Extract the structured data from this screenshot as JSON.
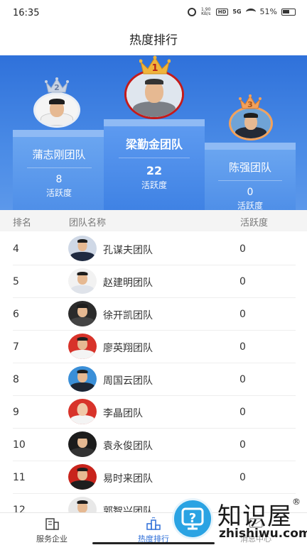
{
  "status_bar": {
    "time": "16:35",
    "net_speed": "1.90 KB/s",
    "hd": "HD",
    "network": "5G",
    "battery": "51%"
  },
  "page": {
    "title": "热度排行"
  },
  "podium": [
    {
      "rank": "2",
      "name": "蒲志刚团队",
      "score": "8",
      "label": "活跃度"
    },
    {
      "rank": "1",
      "name": "梁勤金团队",
      "score": "22",
      "label": "活跃度"
    },
    {
      "rank": "3",
      "name": "陈强团队",
      "score": "0",
      "label": "活跃度"
    }
  ],
  "table": {
    "headers": {
      "rank": "排名",
      "team": "团队名称",
      "activity": "活跃度"
    },
    "rows": [
      {
        "rank": "4",
        "name": "孔谋夫团队",
        "activity": "0"
      },
      {
        "rank": "5",
        "name": "赵建明团队",
        "activity": "0"
      },
      {
        "rank": "6",
        "name": "徐开凯团队",
        "activity": "0"
      },
      {
        "rank": "7",
        "name": "廖英翔团队",
        "activity": "0"
      },
      {
        "rank": "8",
        "name": "周国云团队",
        "activity": "0"
      },
      {
        "rank": "9",
        "name": "李晶团队",
        "activity": "0"
      },
      {
        "rank": "10",
        "name": "袁永俊团队",
        "activity": "0"
      },
      {
        "rank": "11",
        "name": "易时来团队",
        "activity": "0"
      },
      {
        "rank": "12",
        "name": "郭智兴团队",
        "activity": ""
      }
    ]
  },
  "bottom_nav": [
    {
      "label": "服务企业",
      "icon": "building-icon"
    },
    {
      "label": "热度排行",
      "icon": "ranking-icon",
      "active": true
    },
    {
      "label": "消息中心",
      "icon": "message-icon"
    }
  ],
  "watermark": {
    "brand": "知识屋",
    "reg": "®",
    "url": "zhishiwu.com"
  },
  "colors": {
    "accent": "#2f6fd8",
    "podium_bg": "#3a7ce0",
    "gold": "#f0b43c",
    "silver": "#c9d3e3",
    "bronze": "#f3a15a"
  }
}
